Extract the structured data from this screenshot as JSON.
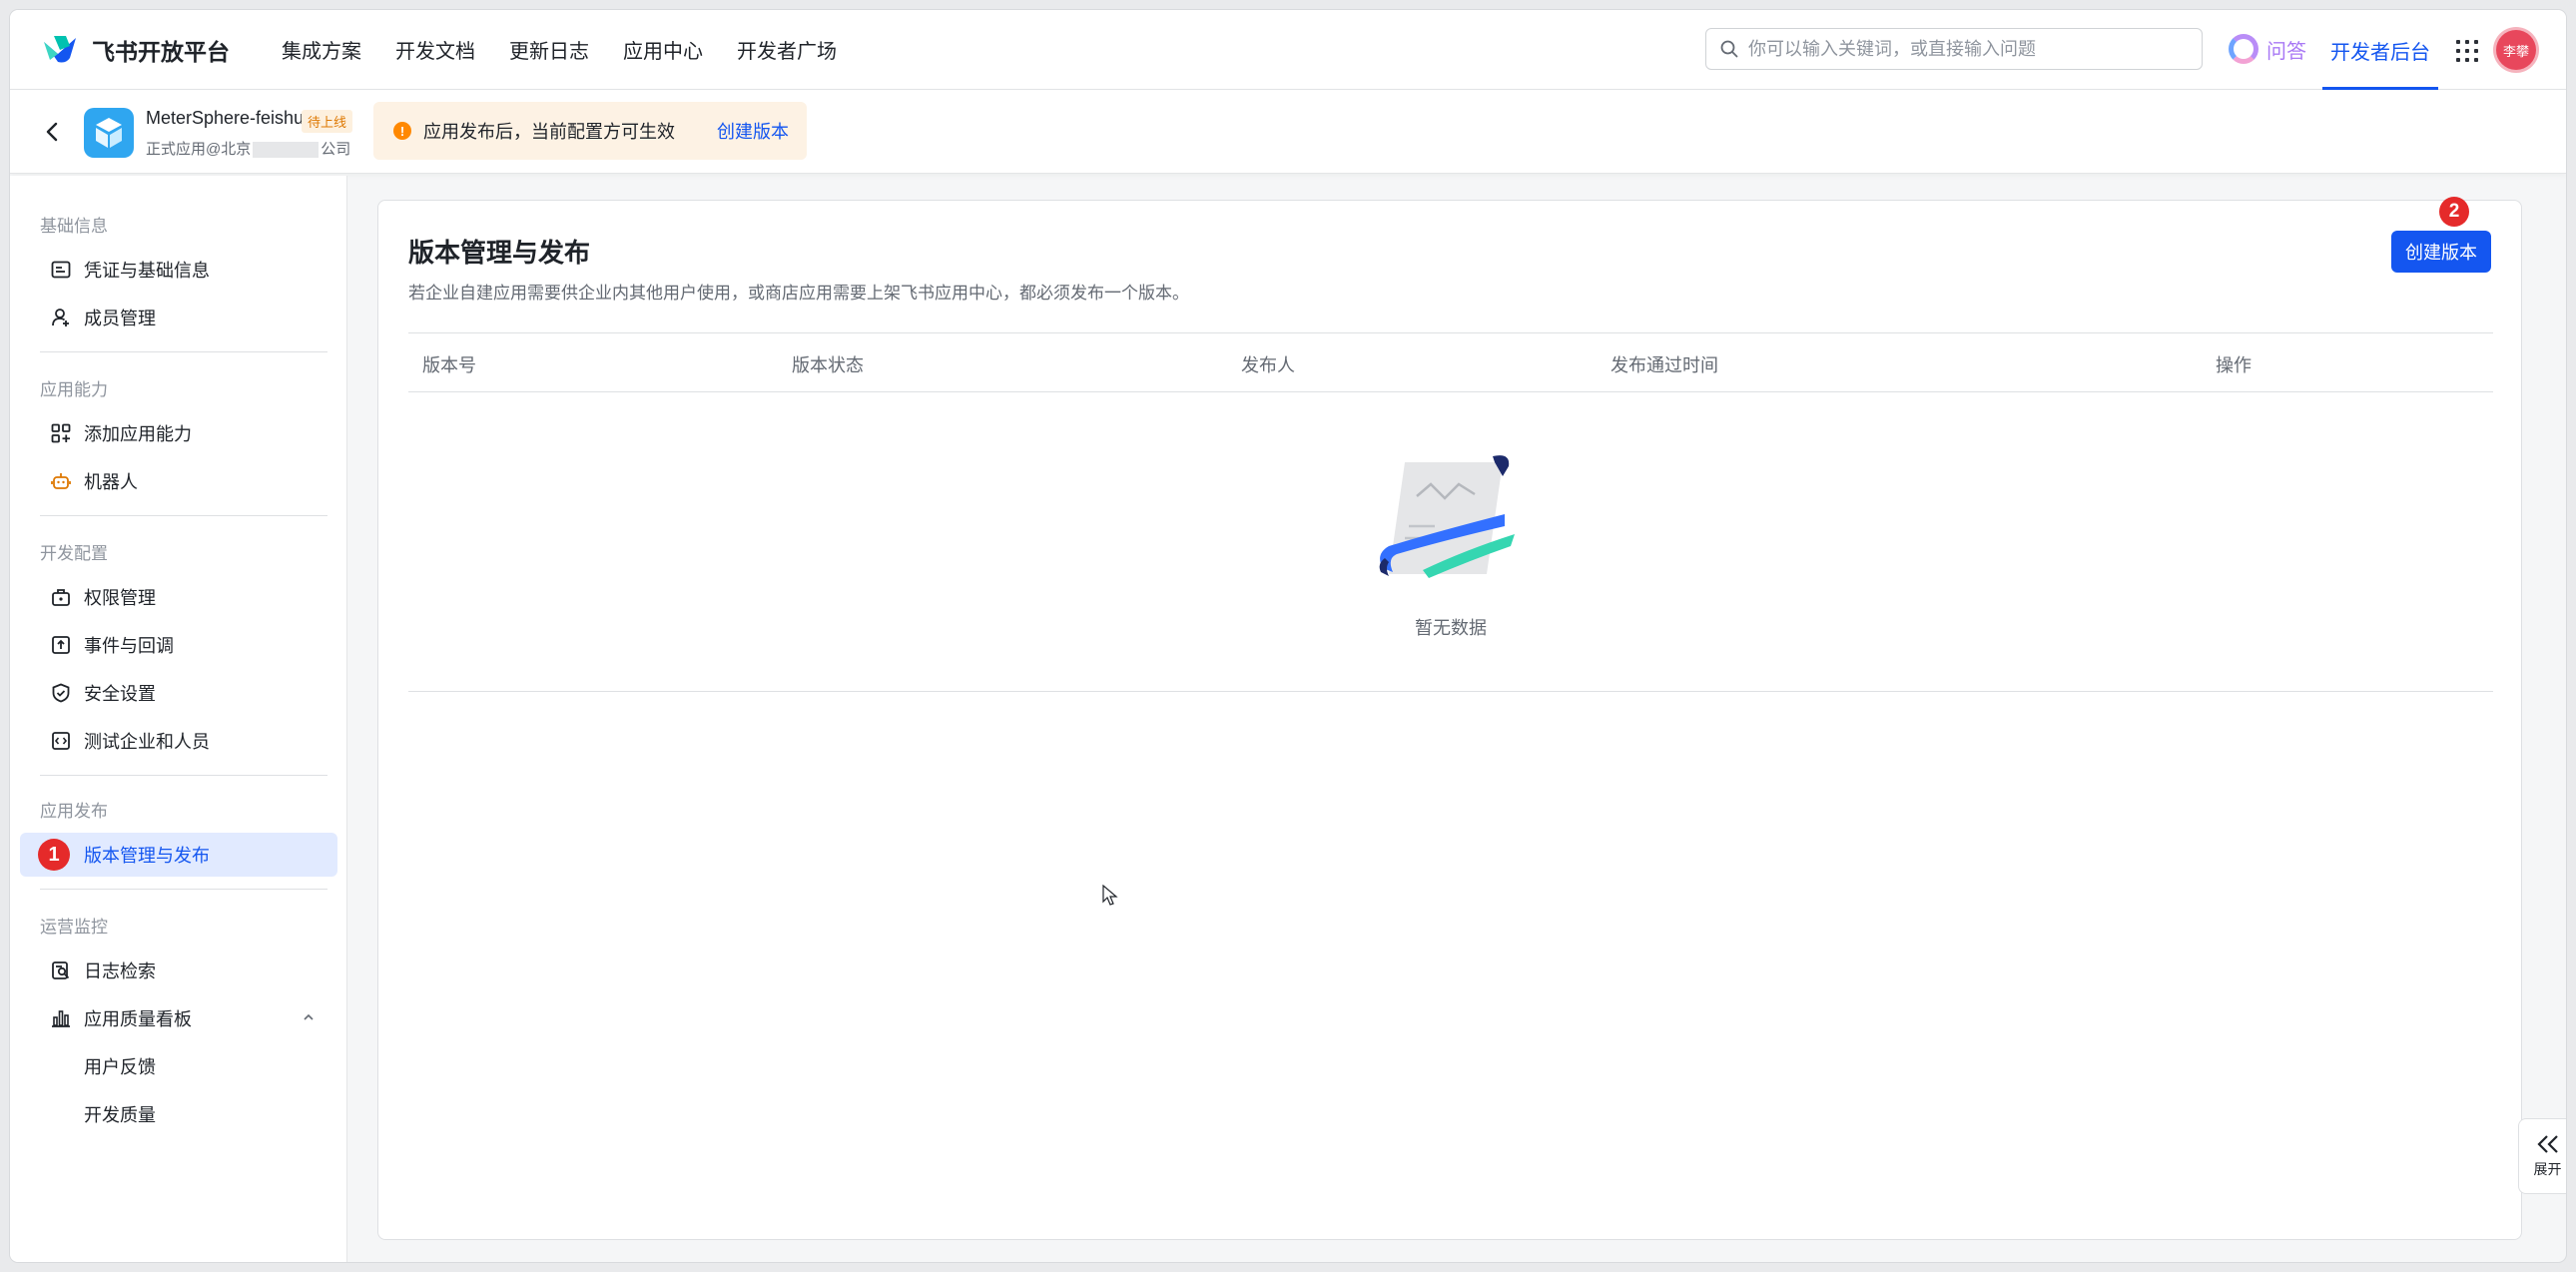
{
  "brand": {
    "name": "飞书开放平台"
  },
  "nav": {
    "links": [
      "集成方案",
      "开发文档",
      "更新日志",
      "应用中心",
      "开发者广场"
    ],
    "search_placeholder": "你可以输入关键词，或直接输入问题",
    "ask_label": "问答",
    "dev_backend_label": "开发者后台",
    "avatar_text": "李攀"
  },
  "app": {
    "name": "MeterSphere-feishu",
    "status_badge": "待上线",
    "sub_prefix": "正式应用@北京",
    "sub_suffix": "公司",
    "notice_icon": "!",
    "notice_text": "应用发布后，当前配置方可生效",
    "notice_link": "创建版本"
  },
  "sidebar": {
    "sections": [
      {
        "title": "基础信息",
        "items": [
          "凭证与基础信息",
          "成员管理"
        ]
      },
      {
        "title": "应用能力",
        "items": [
          "添加应用能力",
          "机器人"
        ]
      },
      {
        "title": "开发配置",
        "items": [
          "权限管理",
          "事件与回调",
          "安全设置",
          "测试企业和人员"
        ]
      },
      {
        "title": "应用发布",
        "items": [
          "版本管理与发布"
        ]
      },
      {
        "title": "运营监控",
        "items": [
          "日志检索",
          "应用质量看板"
        ],
        "sub_items": [
          "用户反馈",
          "开发质量"
        ]
      }
    ]
  },
  "main": {
    "title": "版本管理与发布",
    "description": "若企业自建应用需要供企业内其他用户使用，或商店应用需要上架飞书应用中心，都必须发布一个版本。",
    "create_button": "创建版本",
    "columns": [
      "版本号",
      "版本状态",
      "发布人",
      "发布通过时间",
      "操作"
    ],
    "empty_text": "暂无数据"
  },
  "annotations": {
    "step1": "1",
    "step2": "2"
  },
  "expand_label": "展开",
  "colors": {
    "accent": "#1456f0",
    "badge_red": "#e52a2a",
    "warning": "#ff8800"
  }
}
